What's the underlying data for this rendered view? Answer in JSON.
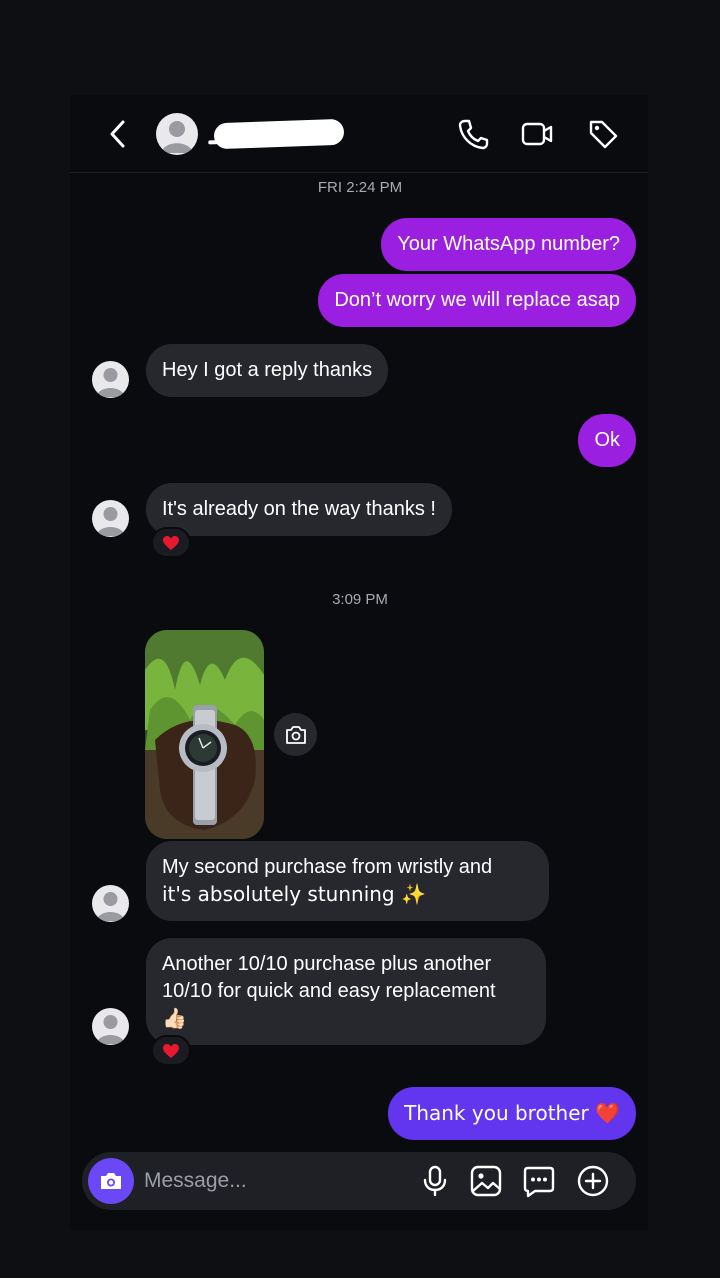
{
  "colors": {
    "outgoing_bubble": "#9b1fe0",
    "outgoing_bubble_last": "#6235ef",
    "incoming_bubble": "#26282e",
    "background": "#0a0b0f",
    "camera_button": "#6b48f5",
    "heart": "#e8182f"
  },
  "header": {
    "back_icon": "chevron-left-icon",
    "call_icon": "phone-icon",
    "video_icon": "video-camera-icon",
    "tag_icon": "tag-icon"
  },
  "timestamps": [
    "FRI 2:24 PM",
    "3:09 PM"
  ],
  "messages": [
    {
      "direction": "out",
      "text": "Your WhatsApp number?"
    },
    {
      "direction": "out",
      "text": "Don’t worry we will replace asap"
    },
    {
      "direction": "in",
      "text": "Hey I got a reply thanks"
    },
    {
      "direction": "out",
      "text": "Ok"
    },
    {
      "direction": "in",
      "text": "It's already on the way thanks !",
      "reaction": "heart"
    },
    {
      "direction": "in",
      "type": "photo",
      "description_icon": "photo-thumbnail"
    },
    {
      "direction": "in",
      "lines": [
        "My second purchase from wristly and",
        "it's absolutely stunning ✨"
      ]
    },
    {
      "direction": "in",
      "lines": [
        "Another 10/10 purchase plus another",
        "10/10 for quick and easy replacement",
        "👍🏻"
      ],
      "reaction": "heart"
    },
    {
      "direction": "out",
      "text": "Thank you brother ❤️"
    }
  ],
  "composer": {
    "placeholder": "Message...",
    "icons": [
      "camera-icon",
      "microphone-icon",
      "gallery-icon",
      "sticker-icon",
      "plus-icon"
    ]
  }
}
